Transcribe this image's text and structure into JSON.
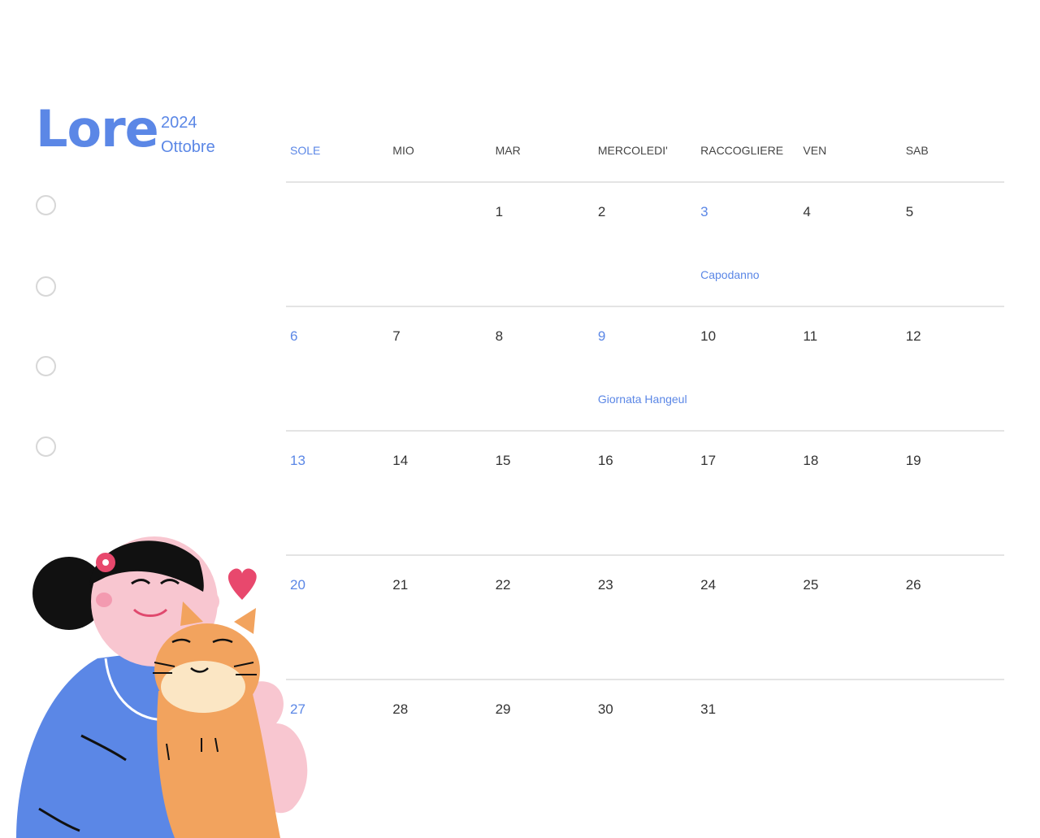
{
  "header": {
    "brand": "Lore",
    "year": "2024",
    "month": "Ottobre"
  },
  "checklist": {
    "count": 4
  },
  "calendar": {
    "weekdays": [
      "SOLE",
      "MIO",
      "MAR",
      "MERCOLEDI'",
      "RACCOGLIERE",
      "VEN",
      "SAB"
    ],
    "weeks": [
      [
        "",
        "",
        "1",
        "2",
        "3",
        "4",
        "5"
      ],
      [
        "6",
        "7",
        "8",
        "9",
        "10",
        "11",
        "12"
      ],
      [
        "13",
        "14",
        "15",
        "16",
        "17",
        "18",
        "19"
      ],
      [
        "20",
        "21",
        "22",
        "23",
        "24",
        "25",
        "26"
      ],
      [
        "27",
        "28",
        "29",
        "30",
        "31",
        "",
        ""
      ]
    ],
    "events": [
      {
        "week": 0,
        "day": 4,
        "label": "Capodanno"
      },
      {
        "week": 1,
        "day": 3,
        "label": "Giornata Hangeul"
      }
    ]
  },
  "colors": {
    "accent": "#5b87e6",
    "text": "#333333",
    "line": "#e4e4e4"
  },
  "illustration": {
    "icon": "girl-hugging-cat-illustration"
  }
}
